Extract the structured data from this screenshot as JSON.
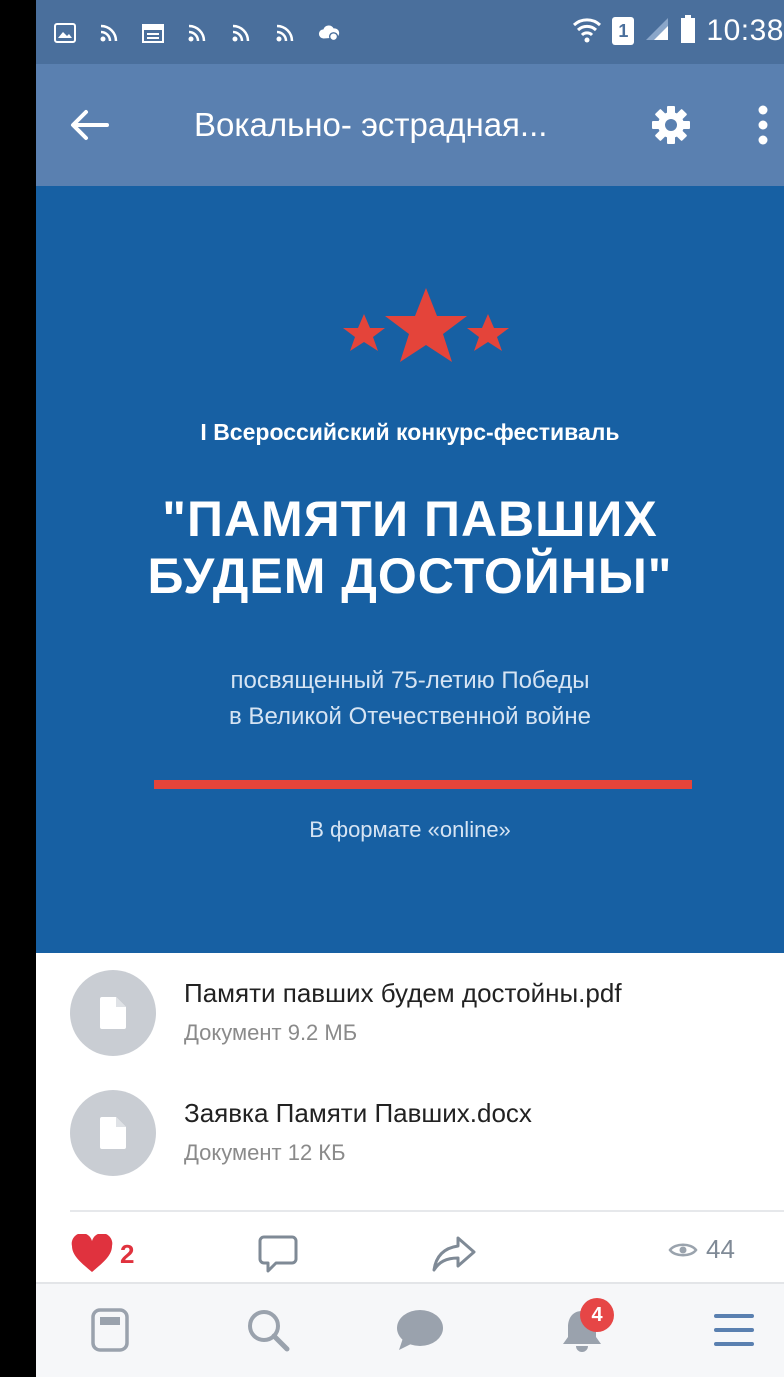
{
  "status_bar": {
    "time": "10:38",
    "sim_slot": "1",
    "left_icons": [
      "image-icon",
      "rss-icon",
      "calendar-icon",
      "rss-icon",
      "rss-icon",
      "rss-icon",
      "cloud-sync-icon"
    ]
  },
  "header": {
    "title": "Вокально- эстрадная..."
  },
  "banner": {
    "kicker": "I Всероссийский конкурс-фестиваль",
    "title_line1": "\"ПАМЯТИ ПАВШИХ",
    "title_line2": "БУДЕМ ДОСТОЙНЫ\"",
    "subtitle_line1": "посвященный 75-летию Победы",
    "subtitle_line2": "в Великой Отечественной войне",
    "format": "В формате «online»",
    "colors": {
      "background": "#1760a3",
      "accent": "#e4443a"
    }
  },
  "documents": [
    {
      "name": "Памяти павших будем достойны.pdf",
      "meta": "Документ 9.2 МБ"
    },
    {
      "name": "Заявка Памяти Павших.docx",
      "meta": "Документ 12 КБ"
    }
  ],
  "actions": {
    "likes": "2",
    "views": "44"
  },
  "bottom_nav": {
    "notifications_badge": "4",
    "items": [
      "news-icon",
      "search-icon",
      "messages-icon",
      "notifications-icon",
      "menu-icon"
    ]
  }
}
